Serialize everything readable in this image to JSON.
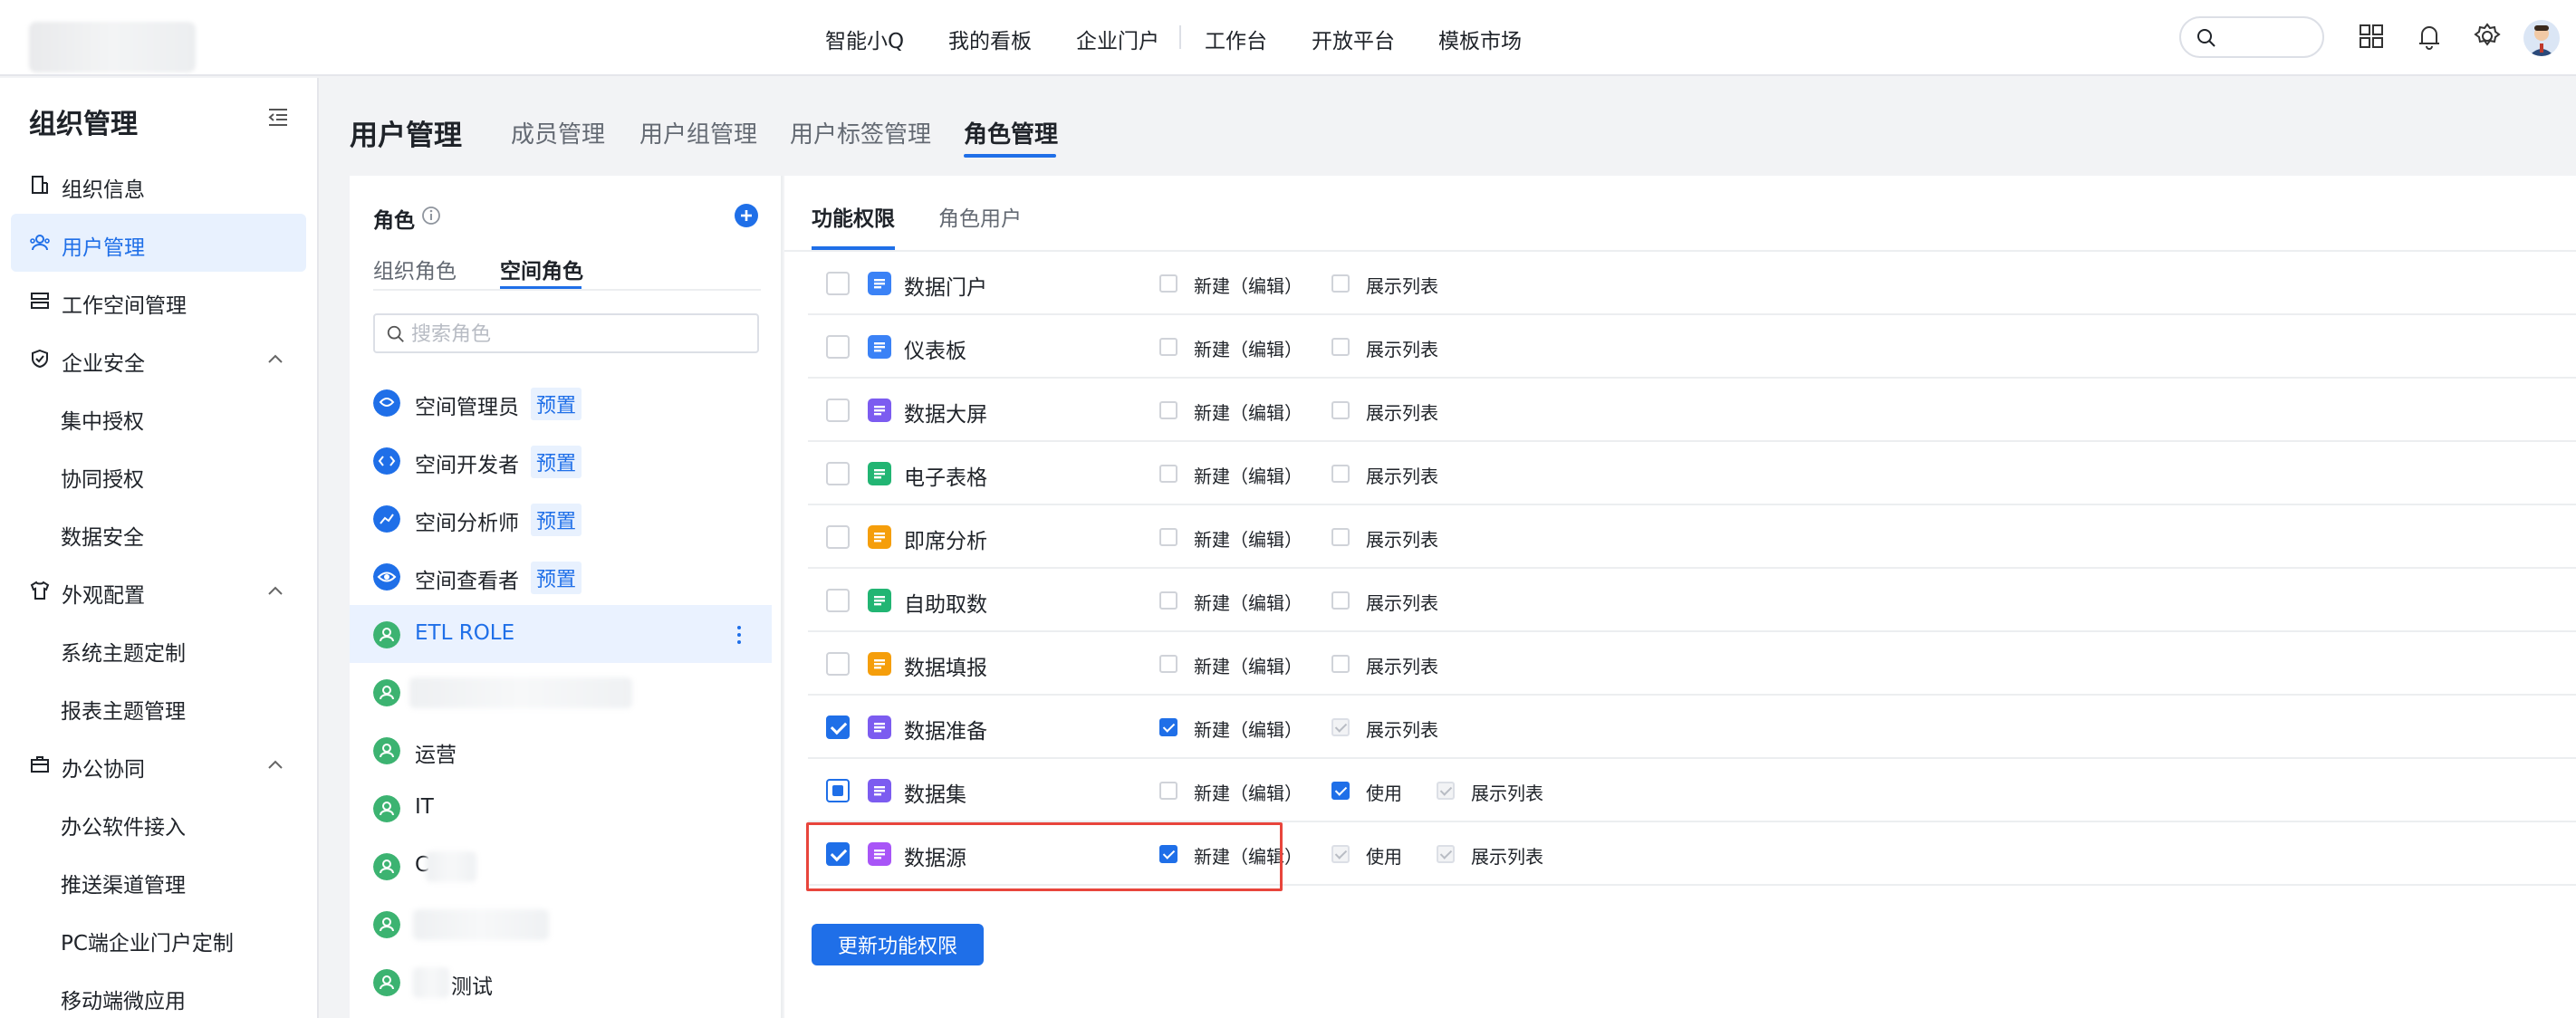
{
  "topnav": {
    "items": [
      "智能小Q",
      "我的看板",
      "企业门户",
      "工作台",
      "开放平台",
      "模板市场"
    ]
  },
  "sidebar": {
    "title": "组织管理",
    "items": [
      {
        "label": "组织信息",
        "icon": "building-icon"
      },
      {
        "label": "用户管理",
        "icon": "users-icon",
        "active": true
      },
      {
        "label": "工作空间管理",
        "icon": "workspace-icon"
      },
      {
        "label": "企业安全",
        "icon": "shield-icon",
        "expanded": true
      },
      {
        "label": "集中授权"
      },
      {
        "label": "协同授权"
      },
      {
        "label": "数据安全"
      },
      {
        "label": "外观配置",
        "icon": "shirt-icon",
        "expanded": true
      },
      {
        "label": "系统主题定制"
      },
      {
        "label": "报表主题管理"
      },
      {
        "label": "办公协同",
        "icon": "briefcase-icon",
        "expanded": true
      },
      {
        "label": "办公软件接入"
      },
      {
        "label": "推送渠道管理"
      },
      {
        "label": "PC端企业门户定制"
      },
      {
        "label": "移动端微应用"
      }
    ]
  },
  "header": {
    "title": "用户管理",
    "tabs": [
      "成员管理",
      "用户组管理",
      "用户标签管理",
      "角色管理"
    ],
    "active_tab": "角色管理"
  },
  "roles": {
    "heading": "角色",
    "tabs": [
      "组织角色",
      "空间角色"
    ],
    "active_tab": "空间角色",
    "search_placeholder": "搜索角色",
    "list": [
      {
        "name": "空间管理员",
        "badge": "预置",
        "color": "#1f6fe8"
      },
      {
        "name": "空间开发者",
        "badge": "预置",
        "color": "#1f6fe8"
      },
      {
        "name": "空间分析师",
        "badge": "预置",
        "color": "#1f6fe8"
      },
      {
        "name": "空间查看者",
        "badge": "预置",
        "color": "#1f6fe8"
      },
      {
        "name": "ETL ROLE",
        "active": true,
        "color": "#3cb371"
      },
      {
        "name": "",
        "color": "#3cb371"
      },
      {
        "name": "运营",
        "color": "#3cb371"
      },
      {
        "name": "IT",
        "color": "#3cb371"
      },
      {
        "name": "C",
        "color": "#3cb371"
      },
      {
        "name": "",
        "color": "#3cb371"
      },
      {
        "name": "测试",
        "color": "#3cb371"
      }
    ]
  },
  "permissions": {
    "tabs": [
      "功能权限",
      "角色用户"
    ],
    "active_tab": "功能权限",
    "rows": [
      {
        "name": "数据门户",
        "icon_color": "#3b82f6",
        "state": "unchecked",
        "perms": [
          {
            "label": "新建（编辑）",
            "state": "unchecked"
          },
          {
            "label": "展示列表",
            "state": "unchecked"
          }
        ]
      },
      {
        "name": "仪表板",
        "icon_color": "#3b82f6",
        "state": "unchecked",
        "perms": [
          {
            "label": "新建（编辑）",
            "state": "unchecked"
          },
          {
            "label": "展示列表",
            "state": "unchecked"
          }
        ]
      },
      {
        "name": "数据大屏",
        "icon_color": "#7c5cf0",
        "state": "unchecked",
        "perms": [
          {
            "label": "新建（编辑）",
            "state": "unchecked"
          },
          {
            "label": "展示列表",
            "state": "unchecked"
          }
        ]
      },
      {
        "name": "电子表格",
        "icon_color": "#22b573",
        "state": "unchecked",
        "perms": [
          {
            "label": "新建（编辑）",
            "state": "unchecked"
          },
          {
            "label": "展示列表",
            "state": "unchecked"
          }
        ]
      },
      {
        "name": "即席分析",
        "icon_color": "#f59e0b",
        "state": "unchecked",
        "perms": [
          {
            "label": "新建（编辑）",
            "state": "unchecked"
          },
          {
            "label": "展示列表",
            "state": "unchecked"
          }
        ]
      },
      {
        "name": "自助取数",
        "icon_color": "#22b573",
        "state": "unchecked",
        "perms": [
          {
            "label": "新建（编辑）",
            "state": "unchecked"
          },
          {
            "label": "展示列表",
            "state": "unchecked"
          }
        ]
      },
      {
        "name": "数据填报",
        "icon_color": "#f59e0b",
        "state": "unchecked",
        "perms": [
          {
            "label": "新建（编辑）",
            "state": "unchecked"
          },
          {
            "label": "展示列表",
            "state": "unchecked"
          }
        ]
      },
      {
        "name": "数据准备",
        "icon_color": "#7c5cf0",
        "state": "checked",
        "perms": [
          {
            "label": "新建（编辑）",
            "state": "checked"
          },
          {
            "label": "展示列表",
            "state": "disabled"
          }
        ]
      },
      {
        "name": "数据集",
        "icon_color": "#7c5cf0",
        "state": "indeterminate",
        "perms": [
          {
            "label": "新建（编辑）",
            "state": "unchecked"
          },
          {
            "label": "使用",
            "state": "checked"
          },
          {
            "label": "展示列表",
            "state": "disabled"
          }
        ]
      },
      {
        "name": "数据源",
        "icon_color": "#a855f7",
        "state": "checked",
        "perms": [
          {
            "label": "新建（编辑）",
            "state": "checked"
          },
          {
            "label": "使用",
            "state": "disabled"
          },
          {
            "label": "展示列表",
            "state": "disabled"
          }
        ]
      }
    ],
    "update_button": "更新功能权限"
  },
  "colors": {
    "accent": "#1f6fe8",
    "highlight": "#e8453c"
  }
}
